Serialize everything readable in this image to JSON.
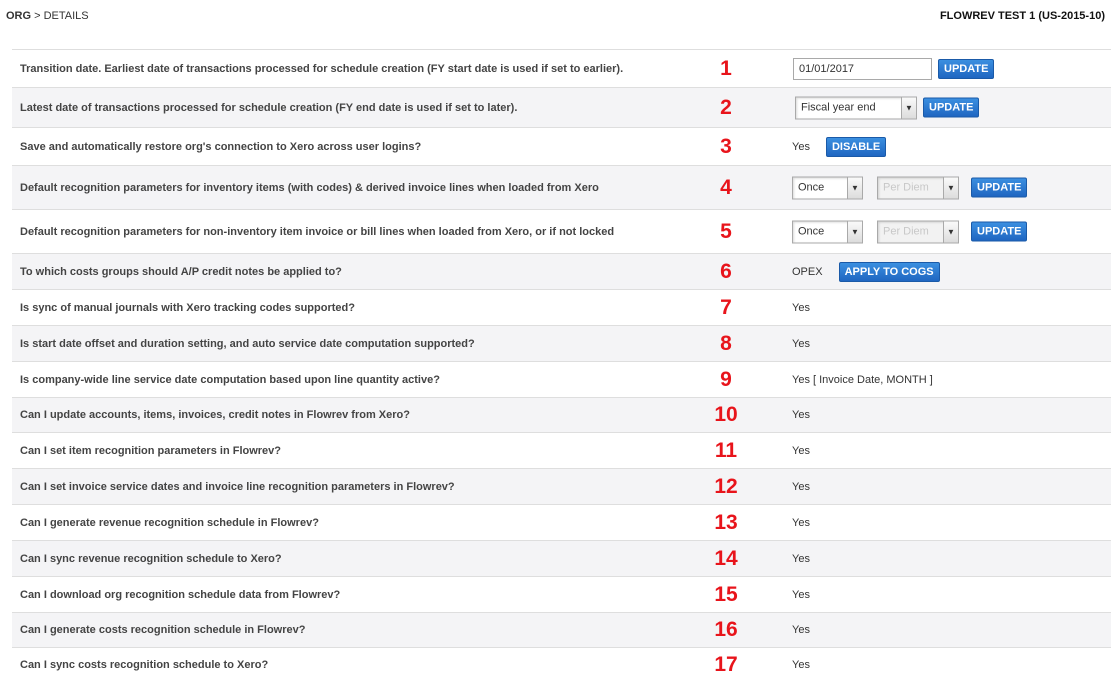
{
  "breadcrumb": {
    "org": "ORG",
    "separator": " > ",
    "current": "DETAILS"
  },
  "org_name": "FLOWREV TEST 1 (US-2015-10)",
  "colors": {
    "number": "#e8141b",
    "button": "#2a7ad2",
    "row_alt": "#f4f4f6"
  },
  "rows": [
    {
      "question": "Transition date.   Earliest date of transactions processed for schedule creation (FY start date is used if set to earlier).",
      "number": "1",
      "input_value": "01/01/2017",
      "button": "UPDATE"
    },
    {
      "question": "Latest date of transactions processed for schedule creation (FY end date is used if set to later).",
      "number": "2",
      "select_value": "Fiscal year end",
      "button": "UPDATE"
    },
    {
      "question": "Save and automatically restore org's connection to Xero across user logins?",
      "number": "3",
      "value": "Yes",
      "button": "DISABLE"
    },
    {
      "question": "Default recognition parameters for inventory items (with codes) & derived invoice lines when loaded from Xero",
      "number": "4",
      "select_value": "Once",
      "select2_value": "Per Diem",
      "button": "UPDATE"
    },
    {
      "question": "Default recognition parameters for non-inventory item invoice or bill lines when loaded from Xero, or if not locked",
      "number": "5",
      "select_value": "Once",
      "select2_value": "Per Diem",
      "button": "UPDATE"
    },
    {
      "question": "To which costs groups should A/P credit notes be applied to?",
      "number": "6",
      "value": "OPEX",
      "button": "APPLY TO COGS"
    },
    {
      "question": "Is sync of manual journals with Xero tracking codes supported?",
      "number": "7",
      "value": "Yes"
    },
    {
      "question": "Is start date offset and duration setting, and auto service date computation supported?",
      "number": "8",
      "value": "Yes"
    },
    {
      "question": "Is company-wide line service date computation based upon line quantity active?",
      "number": "9",
      "value": "Yes [ Invoice Date, MONTH ]"
    },
    {
      "question": "Can I update accounts, items, invoices, credit notes in Flowrev from Xero?",
      "number": "10",
      "value": "Yes"
    },
    {
      "question": "Can I set item recognition parameters in Flowrev?",
      "number": "11",
      "value": "Yes"
    },
    {
      "question": "Can I set invoice service dates and invoice line recognition parameters in Flowrev?",
      "number": "12",
      "value": "Yes"
    },
    {
      "question": "Can I generate revenue recognition schedule in Flowrev?",
      "number": "13",
      "value": "Yes"
    },
    {
      "question": "Can I sync revenue recognition schedule to Xero?",
      "number": "14",
      "value": "Yes"
    },
    {
      "question": "Can I download org recognition schedule data from Flowrev?",
      "number": "15",
      "value": "Yes"
    },
    {
      "question": "Can I generate costs recognition schedule in Flowrev?",
      "number": "16",
      "value": "Yes"
    },
    {
      "question": "Can I sync costs recognition schedule to Xero?",
      "number": "17",
      "value": "Yes"
    }
  ]
}
